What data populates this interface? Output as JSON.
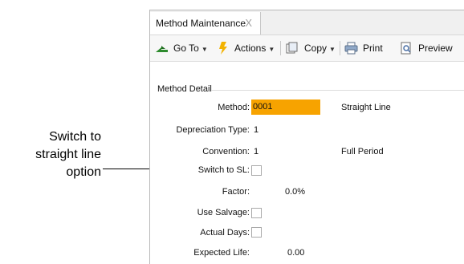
{
  "callout": {
    "line1": "Switch to",
    "line2": "straight line",
    "line3": "option"
  },
  "tab": {
    "label": "Method Maintenance",
    "close_glyph": "X"
  },
  "toolbar": {
    "goto_label": "Go To",
    "actions_label": "Actions",
    "copy_label": "Copy",
    "print_label": "Print",
    "preview_label": "Preview",
    "icons": [
      "goto-arrow-icon",
      "actions-lightning-icon",
      "copy-icon",
      "printer-icon",
      "preview-icon"
    ]
  },
  "section": {
    "title": "Method Detail"
  },
  "fields": {
    "method_label": "Method:",
    "method_value": "0001",
    "method_description": "Straight Line",
    "depreciation_type_label": "Depreciation Type:",
    "depreciation_type_value": "1",
    "convention_label": "Convention:",
    "convention_value": "1",
    "convention_description": "Full Period",
    "switch_to_sl_label": "Switch to SL:",
    "factor_label": "Factor:",
    "factor_value": "0.0%",
    "use_salvage_label": "Use Salvage:",
    "actual_days_label": "Actual Days:",
    "expected_life_label": "Expected Life:",
    "expected_life_value": "0.00"
  },
  "colors": {
    "method_highlight": "#f7a300",
    "goto_icon": "#2e8b2e",
    "actions_icon": "#f2b200"
  }
}
